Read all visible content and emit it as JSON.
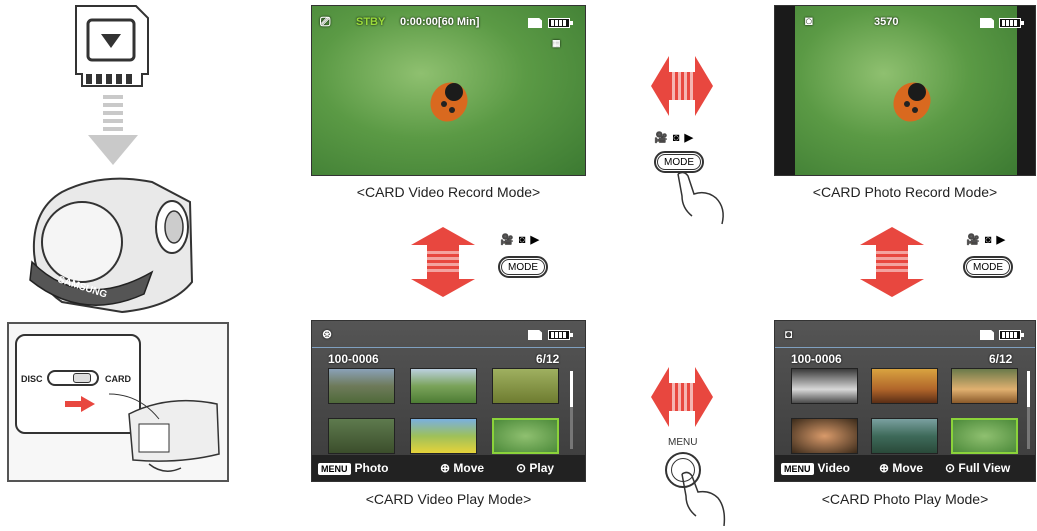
{
  "device": {
    "disc_label": "DISC",
    "card_label": "CARD",
    "brand": "SAMSUNG"
  },
  "video_record": {
    "stby": "STBY",
    "time": "0:00:00[60 Min]",
    "caption": "<CARD Video Record Mode>"
  },
  "photo_record": {
    "count": "3570",
    "caption": "<CARD Photo Record Mode>"
  },
  "video_play": {
    "file": "100-0006",
    "page": "6/12",
    "menu_tag": "MENU",
    "menu_item": "Photo",
    "move": "Move",
    "action": "Play",
    "caption": "<CARD Video Play Mode>"
  },
  "photo_play": {
    "file": "100-0006",
    "page": "6/12",
    "menu_tag": "MENU",
    "menu_item": "Video",
    "move": "Move",
    "action": "Full View",
    "caption": "<CARD Photo Play Mode>"
  },
  "buttons": {
    "mode": "MODE",
    "menu": "MENU"
  },
  "colors": {
    "arrow": "#e8473f",
    "highlight": "#8bd33a"
  }
}
